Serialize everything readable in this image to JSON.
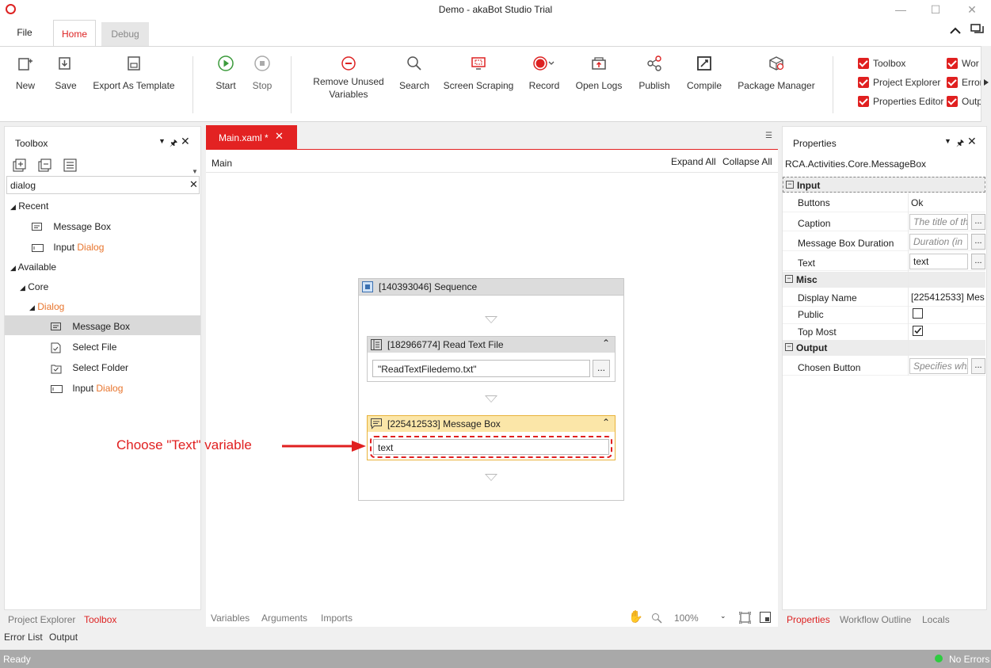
{
  "window": {
    "title": "Demo - akaBot Studio Trial"
  },
  "ribbon_tabs": {
    "file": "File",
    "home": "Home",
    "debug": "Debug"
  },
  "ribbon": {
    "new": "New",
    "save": "Save",
    "export_template": "Export As Template",
    "start": "Start",
    "stop": "Stop",
    "remove_unused_1": "Remove Unused",
    "remove_unused_2": "Variables",
    "search": "Search",
    "screen_scraping": "Screen Scraping",
    "record": "Record",
    "open_logs": "Open Logs",
    "publish": "Publish",
    "compile": "Compile",
    "package_manager": "Package Manager",
    "checks": {
      "toolbox": "Toolbox",
      "project_explorer": "Project Explorer",
      "properties_editor": "Properties Editor",
      "workflow": "Wor",
      "errors": "Error",
      "output": "Outp"
    }
  },
  "toolbox": {
    "title": "Toolbox",
    "search_value": "dialog",
    "recent_label": "Recent",
    "recent_items": [
      {
        "pre": "Message Box",
        "hl": ""
      },
      {
        "pre": "Input ",
        "hl": "Dialog"
      }
    ],
    "available_label": "Available",
    "core_label": "Core",
    "dialog_label": "Dialog",
    "dialog_items": [
      {
        "pre": "Message Box",
        "hl": ""
      },
      {
        "pre": "Select File",
        "hl": ""
      },
      {
        "pre": "Select Folder",
        "hl": ""
      },
      {
        "pre": "Input ",
        "hl": "Dialog"
      }
    ]
  },
  "editor": {
    "tab_label": "Main.xaml *",
    "breadcrumb": "Main",
    "expand_all": "Expand All",
    "collapse_all": "Collapse All",
    "sequence_title": "[140393046] Sequence",
    "read_text_title": "[182966774] Read Text File",
    "read_text_value": "\"ReadTextFiledemo.txt\"",
    "message_box_title": "[225412533] Message Box",
    "message_box_value": "text",
    "annotation": "Choose \"Text\" variable",
    "bottom_tabs": {
      "variables": "Variables",
      "arguments": "Arguments",
      "imports": "Imports"
    },
    "zoom": "100%"
  },
  "properties": {
    "title": "Properties",
    "type_name": "RCA.Activities.Core.MessageBox",
    "input_section": "Input",
    "misc_section": "Misc",
    "output_section": "Output",
    "buttons_label": "Buttons",
    "buttons_value": "Ok",
    "caption_label": "Caption",
    "caption_placeholder": "The title of the",
    "duration_label": "Message Box Duration",
    "duration_placeholder": "Duration (in",
    "text_label": "Text",
    "text_value": "text",
    "display_name_label": "Display Name",
    "display_name_value": "[225412533] Mes",
    "public_label": "Public",
    "public_checked": false,
    "top_most_label": "Top Most",
    "top_most_checked": true,
    "chosen_button_label": "Chosen Button",
    "chosen_button_placeholder": "Specifies whi"
  },
  "left_bottom_tabs": {
    "project_explorer": "Project Explorer",
    "toolbox": "Toolbox"
  },
  "right_bottom_tabs": {
    "properties": "Properties",
    "workflow_outline": "Workflow Outline",
    "locals": "Locals"
  },
  "output_tabs": {
    "error_list": "Error List",
    "output": "Output"
  },
  "status": {
    "left": "Ready",
    "right": "No Errors"
  },
  "colors": {
    "accent": "#e02020",
    "highlight": "#e8742c",
    "message_box_header": "#fbe6a8"
  }
}
